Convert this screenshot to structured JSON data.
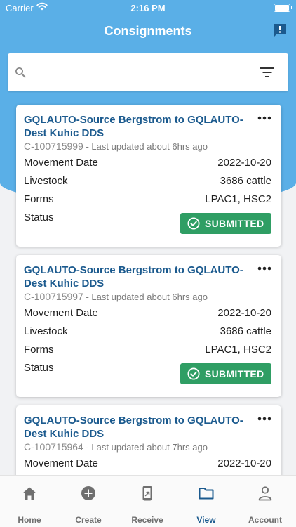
{
  "status_bar": {
    "carrier": "Carrier",
    "time": "2:16 PM"
  },
  "header": {
    "title": "Consignments"
  },
  "search": {
    "placeholder": ""
  },
  "consignments": [
    {
      "title": "GQLAUTO-Source Bergstrom to GQLAUTO-Dest Kuhic DDS",
      "id": "C-100715999",
      "updated": "- Last updated about 6hrs ago",
      "fields": [
        {
          "label": "Movement Date",
          "value": "2022-10-20"
        },
        {
          "label": "Livestock",
          "value": "3686 cattle"
        },
        {
          "label": "Forms",
          "value": "LPAC1, HSC2"
        },
        {
          "label": "Status",
          "value": ""
        }
      ],
      "status": "SUBMITTED"
    },
    {
      "title": "GQLAUTO-Source Bergstrom to GQLAUTO-Dest Kuhic DDS",
      "id": "C-100715997",
      "updated": "- Last updated about 6hrs ago",
      "fields": [
        {
          "label": "Movement Date",
          "value": "2022-10-20"
        },
        {
          "label": "Livestock",
          "value": "3686 cattle"
        },
        {
          "label": "Forms",
          "value": "LPAC1, HSC2"
        },
        {
          "label": "Status",
          "value": ""
        }
      ],
      "status": "SUBMITTED"
    },
    {
      "title": "GQLAUTO-Source Bergstrom to GQLAUTO-Dest Kuhic DDS",
      "id": "C-100715964",
      "updated": "- Last updated about 7hrs ago",
      "fields": [
        {
          "label": "Movement Date",
          "value": "2022-10-20"
        }
      ]
    }
  ],
  "tabs": [
    {
      "label": "Home",
      "icon": "home-icon"
    },
    {
      "label": "Create",
      "icon": "plus-circle-icon"
    },
    {
      "label": "Receive",
      "icon": "phone-receive-icon"
    },
    {
      "label": "View",
      "icon": "folder-icon",
      "active": true
    },
    {
      "label": "Account",
      "icon": "person-icon"
    }
  ],
  "colors": {
    "header_blue": "#5aafe7",
    "title_blue": "#1b5a8e",
    "status_green": "#2f9e64",
    "active_tab": "#1b5a8e",
    "feedback_icon": "#1b5a8e"
  }
}
